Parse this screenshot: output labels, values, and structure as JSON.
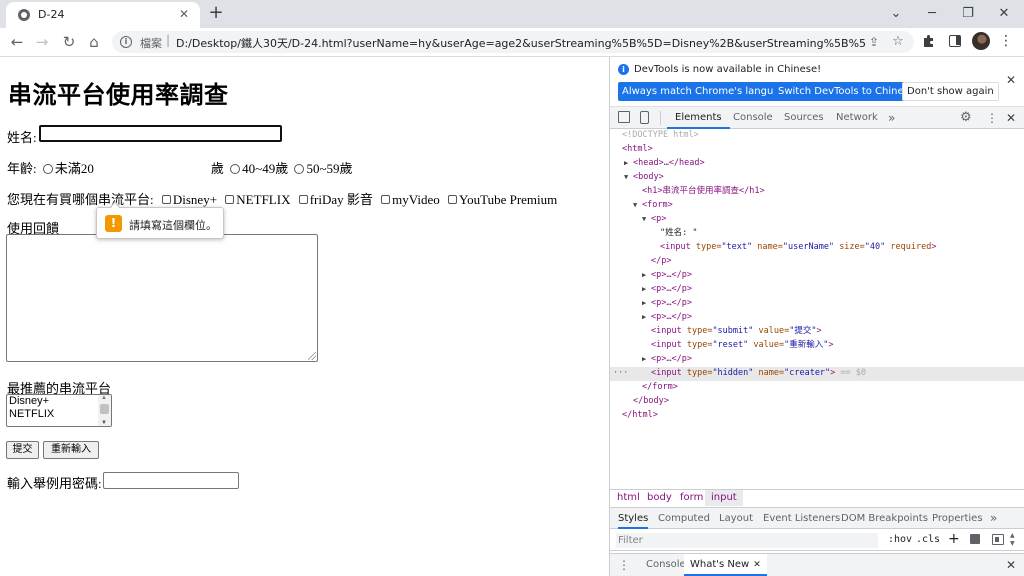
{
  "window": {
    "tab_title": "D-24",
    "new_tab_icon": "plus-icon"
  },
  "toolbar": {
    "url_scheme_label": "檔案",
    "url": "D:/Desktop/鐵人30天/D-24.html?userName=hy&userAge=age2&userStreaming%5B%5D=Disney%2B&userStreaming%5B%5D..."
  },
  "page": {
    "heading": "串流平台使用率調查",
    "name_label": "姓名:",
    "age_label": "年齡:",
    "age_options": [
      "未滿20",
      "歲",
      "40~49歲",
      "50~59歲"
    ],
    "platform_label": "您現在有買哪個串流平台:",
    "platforms": [
      "Disney+",
      "NETFLIX",
      "friDay 影音",
      "myVideo",
      "YouTube Premium"
    ],
    "feedback_label": "使用回饋",
    "recommend_label": "最推薦的串流平台",
    "recommend_options": [
      "Disney+",
      "NETFLIX"
    ],
    "submit_label": "提交",
    "reset_label": "重新輸入",
    "password_label": "輸入舉例用密碼:",
    "validation_message": "請填寫這個欄位。"
  },
  "devtools": {
    "info_text": "DevTools is now available in Chinese!",
    "btn_match": "Always match Chrome's language",
    "btn_switch": "Switch DevTools to Chinese",
    "btn_dontshow": "Don't show again",
    "tabs": [
      "Elements",
      "Console",
      "Sources",
      "Network"
    ],
    "dom": {
      "doctype": "<!DOCTYPE html>",
      "html_open": "<html>",
      "head": "<head>…</head>",
      "body_open": "<body>",
      "h1": "<h1>串流平台使用率調查</h1>",
      "form_open": "<form>",
      "p_open": "<p>",
      "text_node": "\"姓名: \"",
      "input_name_tag": "<input",
      "input_name_type_attr": "type=",
      "input_name_type_val": "\"text\"",
      "input_name_name_attr": "name=",
      "input_name_name_val": "\"userName\"",
      "input_name_size_attr": "size=",
      "input_name_size_val": "\"40\"",
      "input_name_required": "required",
      "input_name_close": ">",
      "p_close": "</p>",
      "p_collapsed": "<p>…</p>",
      "submit_tag": "<input",
      "submit_type_attr": "type=",
      "submit_type_val": "\"submit\"",
      "submit_value_attr": "value=",
      "submit_value_val": "\"提交\"",
      "submit_close": ">",
      "reset_tag": "<input",
      "reset_type_attr": "type=",
      "reset_type_val": "\"reset\"",
      "reset_value_attr": "value=",
      "reset_value_val": "\"重新輸入\"",
      "reset_close": ">",
      "hidden_tag": "<input",
      "hidden_type_attr": "type=",
      "hidden_type_val": "\"hidden\"",
      "hidden_name_attr": "name=",
      "hidden_name_val": "\"creater\"",
      "hidden_close": ">",
      "hidden_ref": "== $0",
      "form_close": "</form>",
      "body_close": "</body>",
      "html_close": "</html>"
    },
    "breadcrumbs": [
      "html",
      "body",
      "form",
      "input"
    ],
    "styles_tabs": [
      "Styles",
      "Computed",
      "Layout",
      "Event Listeners",
      "DOM Breakpoints",
      "Properties"
    ],
    "filter_placeholder": "Filter",
    "hov_label": ":hov",
    "cls_label": ".cls",
    "drawer_console": "Console",
    "drawer_whatsnew": "What's New"
  }
}
